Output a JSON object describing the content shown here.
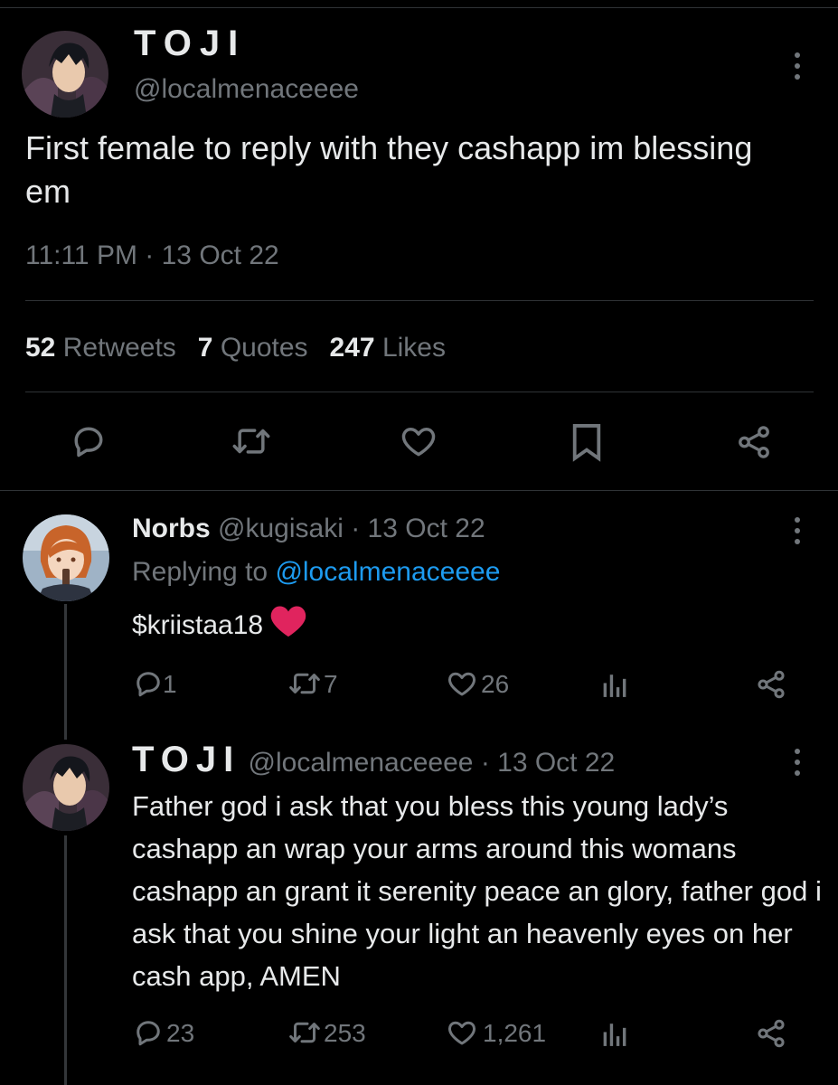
{
  "main_tweet": {
    "author_name": "TOJI",
    "handle": "@localmenaceeee",
    "text": "First female to reply with they cashapp im blessing em",
    "timestamp": "11:11 PM · 13 Oct 22",
    "stats": {
      "retweets_count": "52",
      "retweets_label": "Retweets",
      "quotes_count": "7",
      "quotes_label": "Quotes",
      "likes_count": "247",
      "likes_label": "Likes"
    },
    "actions": [
      "reply-icon",
      "retweet-icon",
      "like-icon",
      "bookmark-icon",
      "share-icon"
    ]
  },
  "reply_1": {
    "author_name": "Norbs",
    "handle": "@kugisaki",
    "date": "· 13 Oct 22",
    "replying_prefix": "Replying to",
    "replying_to": "@localmenaceeee",
    "text": "$kriistaa18",
    "reply_count": "1",
    "retweet_count": "7",
    "like_count": "26"
  },
  "reply_2": {
    "author_name": "TOJI",
    "handle": "@localmenaceeee",
    "date": "· 13 Oct 22",
    "text": "Father god i ask that you bless this young lady’s cashapp an wrap your arms around this womans cashapp an grant it serenity peace an glory, father god i ask that you shine your light an heavenly eyes on her cash app, AMEN",
    "reply_count": "23",
    "retweet_count": "253",
    "like_count": "1,261"
  },
  "colors": {
    "background": "#000000",
    "text": "#e7e9ea",
    "secondary": "#71767b",
    "link": "#1d9bf0",
    "divider": "#2f3336",
    "heart_emoji": "#e0245e"
  }
}
